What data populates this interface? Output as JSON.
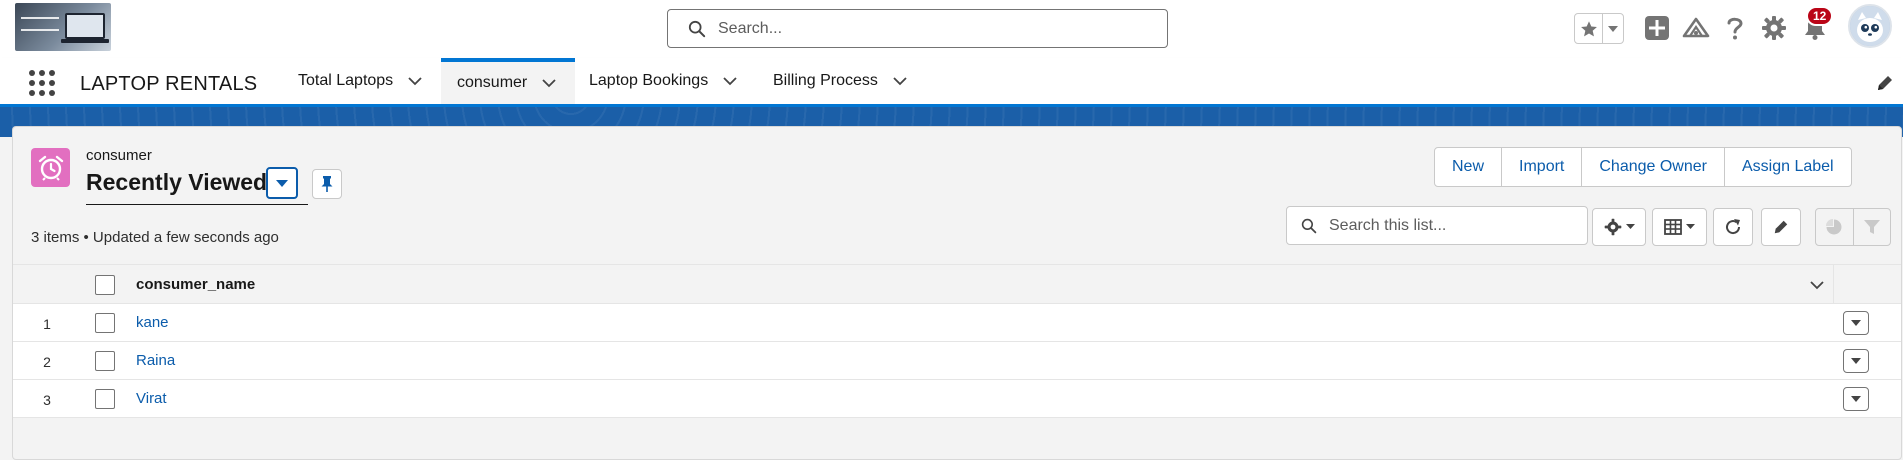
{
  "header": {
    "search_placeholder": "Search...",
    "notification_count": "12"
  },
  "nav": {
    "app_name": "LAPTOP RENTALS",
    "tabs": [
      {
        "label": "Total Laptops",
        "active": false
      },
      {
        "label": "consumer",
        "active": true
      },
      {
        "label": "Laptop Bookings",
        "active": false
      },
      {
        "label": "Billing Process",
        "active": false
      }
    ]
  },
  "list_view": {
    "object_label": "consumer",
    "view_name": "Recently Viewed",
    "meta_text": "3 items • Updated a few seconds ago",
    "actions": [
      "New",
      "Import",
      "Change Owner",
      "Assign Label"
    ],
    "search_placeholder": "Search this list...",
    "columns": [
      "consumer_name"
    ],
    "rows": [
      {
        "num": "1",
        "consumer_name": "kane"
      },
      {
        "num": "2",
        "consumer_name": "Raina"
      },
      {
        "num": "3",
        "consumer_name": "Virat"
      }
    ]
  },
  "colors": {
    "brand_blue": "#0176d3",
    "link_blue": "#0b5cab",
    "object_icon": "#e26fc0",
    "badge_red": "#ba0517"
  }
}
